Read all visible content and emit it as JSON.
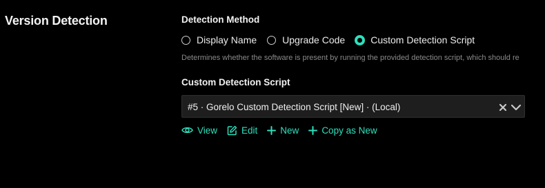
{
  "section": {
    "title": "Version Detection"
  },
  "detection_method": {
    "label": "Detection Method",
    "options": [
      {
        "label": "Display Name",
        "checked": false
      },
      {
        "label": "Upgrade Code",
        "checked": false
      },
      {
        "label": "Custom Detection Script",
        "checked": true
      }
    ],
    "hint": "Determines whether the software is present by running the provided detection script, which should re"
  },
  "custom_script": {
    "label": "Custom Detection Script",
    "selected_value": "#5 · Gorelo Custom Detection Script [New] · (Local)",
    "icons": {
      "clear": "close-icon",
      "expand": "chevron-down-icon"
    }
  },
  "actions": {
    "view_label": "View",
    "edit_label": "Edit",
    "new_label": "New",
    "copy_label": "Copy as New",
    "icons": {
      "view": "eye-icon",
      "edit": "edit-icon",
      "new": "plus-icon",
      "copy": "plus-icon"
    }
  },
  "colors": {
    "background": "#000000",
    "accent": "#2de0bd",
    "text": "#f2f2f2",
    "muted": "#8a8a8a",
    "input_background": "#1e1e1e"
  }
}
